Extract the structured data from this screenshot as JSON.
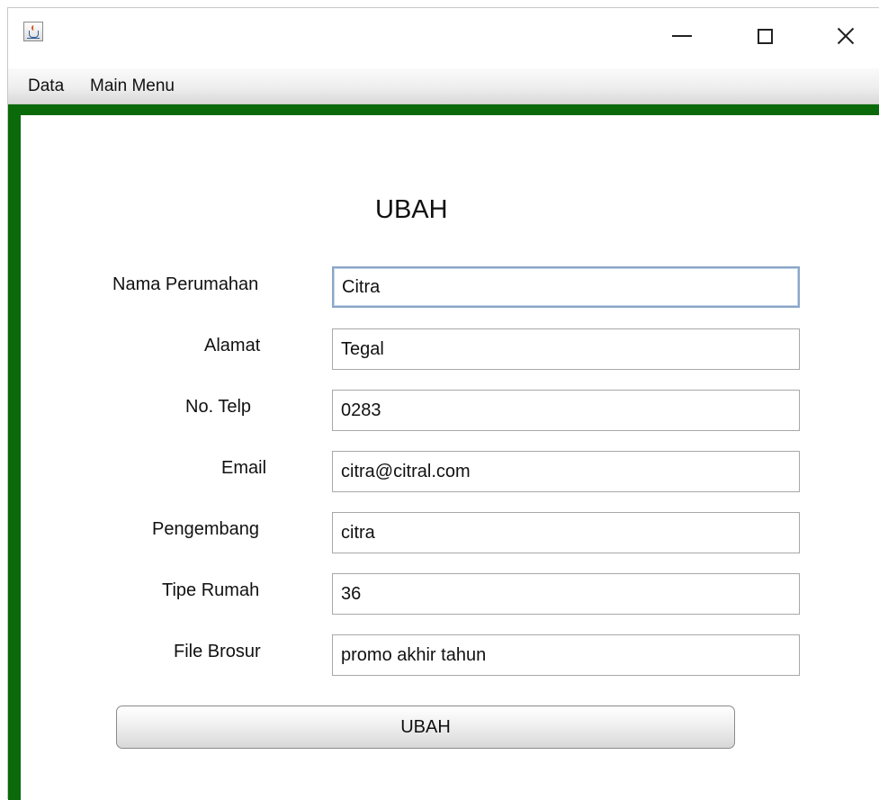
{
  "window": {
    "title": "",
    "icon": "java-cup-icon"
  },
  "menubar": {
    "items": [
      {
        "label": "Data"
      },
      {
        "label": "Main Menu"
      }
    ]
  },
  "form": {
    "title": "UBAH",
    "fields": [
      {
        "label": "Nama Perumahan",
        "value": "Citra"
      },
      {
        "label": "Alamat",
        "value": "Tegal"
      },
      {
        "label": "No. Telp",
        "value": "0283"
      },
      {
        "label": "Email",
        "value": "citra@citral.com"
      },
      {
        "label": "Pengembang",
        "value": "citra"
      },
      {
        "label": "Tipe Rumah",
        "value": "36"
      },
      {
        "label": "File Brosur",
        "value": "promo akhir tahun"
      }
    ],
    "submit_label": "UBAH"
  },
  "colors": {
    "frame": "#0a6a0a",
    "focus_border": "#8aa6c6"
  }
}
